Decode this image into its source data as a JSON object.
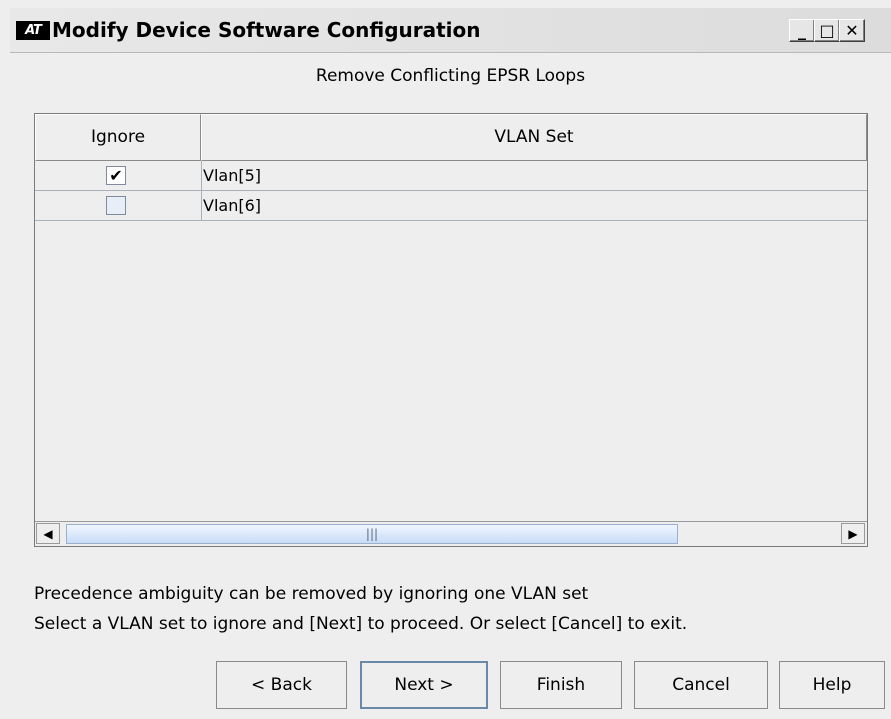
{
  "window": {
    "title": "Modify Device Software Configuration",
    "icon_text": "AT",
    "controls": {
      "minimize": "_",
      "maximize": "□",
      "close": "✕"
    }
  },
  "page": {
    "subtitle": "Remove Conflicting EPSR Loops"
  },
  "table": {
    "columns": [
      "Ignore",
      "VLAN Set"
    ],
    "rows": [
      {
        "ignore": true,
        "check_glyph": "✔",
        "vlan_set": "Vlan[5]"
      },
      {
        "ignore": false,
        "check_glyph": "",
        "vlan_set": "Vlan[6]"
      }
    ],
    "scrollbar": {
      "left_arrow": "◀",
      "right_arrow": "▶",
      "grip": "|||"
    }
  },
  "messages": {
    "line1": "Precedence ambiguity can be removed by ignoring one VLAN set",
    "line2": "Select a VLAN set to ignore and [Next] to proceed. Or select [Cancel] to exit."
  },
  "buttons": {
    "back": "< Back",
    "next": "Next >",
    "finish": "Finish",
    "cancel": "Cancel",
    "help": "Help"
  }
}
